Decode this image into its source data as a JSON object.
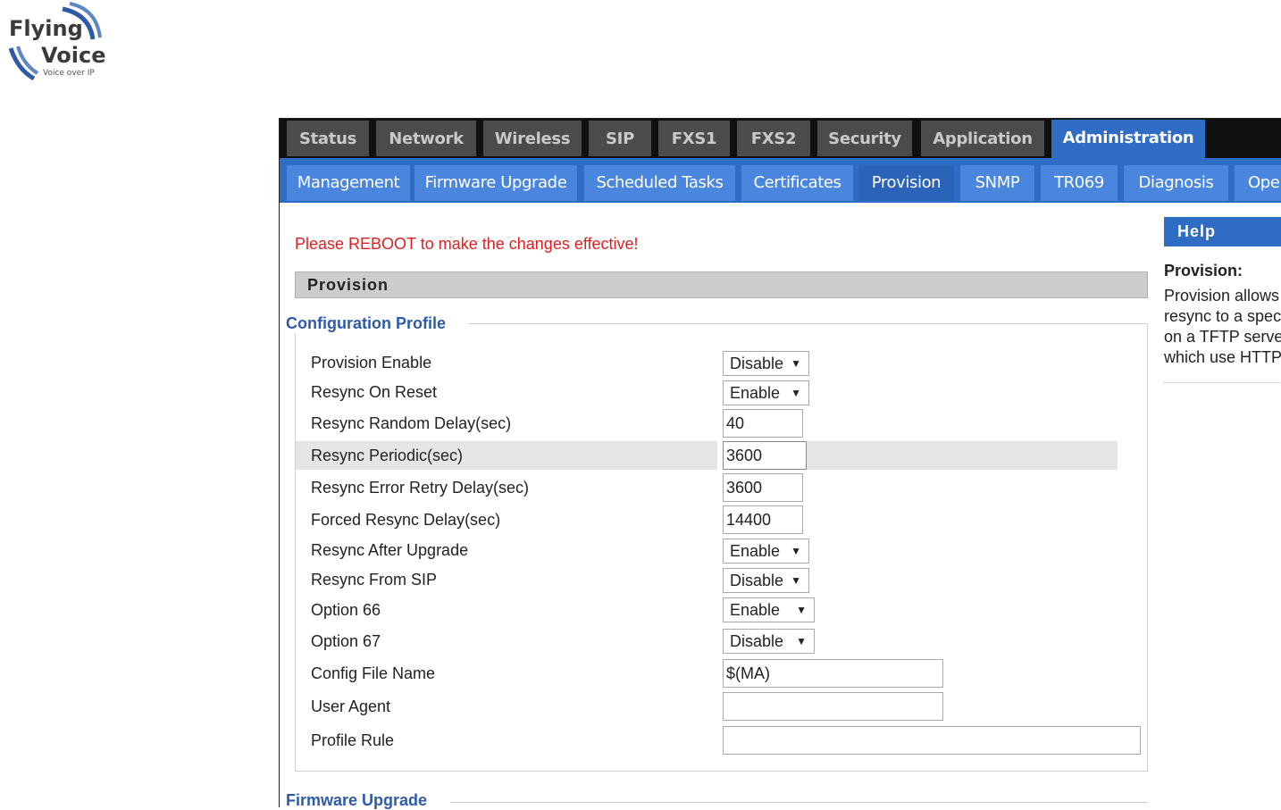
{
  "logo": {
    "line1": "Flying",
    "line2": "Voice",
    "tagline": "Voice over IP"
  },
  "colors": {
    "tab_active": "#2f6cc4",
    "subtab": "#4a86dd",
    "reboot": "#e02020",
    "legend": "#2e5aa8"
  },
  "main_tabs": [
    {
      "label": "Status",
      "active": false
    },
    {
      "label": "Network",
      "active": false
    },
    {
      "label": "Wireless",
      "active": false
    },
    {
      "label": "SIP",
      "active": false
    },
    {
      "label": "FXS1",
      "active": false
    },
    {
      "label": "FXS2",
      "active": false
    },
    {
      "label": "Security",
      "active": false
    },
    {
      "label": "Application",
      "active": false
    },
    {
      "label": "Administration",
      "active": true
    }
  ],
  "sub_tabs": [
    {
      "label": "Management",
      "active": false
    },
    {
      "label": "Firmware Upgrade",
      "active": false
    },
    {
      "label": "Scheduled Tasks",
      "active": false
    },
    {
      "label": "Certificates",
      "active": false
    },
    {
      "label": "Provision",
      "active": true
    },
    {
      "label": "SNMP",
      "active": false
    },
    {
      "label": "TR069",
      "active": false
    },
    {
      "label": "Diagnosis",
      "active": false
    },
    {
      "label": "Oper",
      "active": false
    }
  ],
  "notice": "Please REBOOT to make the changes effective!",
  "section_title": "Provision",
  "config_profile": {
    "legend": "Configuration Profile",
    "fields": [
      {
        "label": "Provision Enable",
        "type": "select",
        "value": "Disable"
      },
      {
        "label": "Resync On Reset",
        "type": "select",
        "value": "Enable"
      },
      {
        "label": "Resync Random Delay(sec)",
        "type": "text",
        "value": "40"
      },
      {
        "label": "Resync Periodic(sec)",
        "type": "text",
        "value": "3600"
      },
      {
        "label": "Resync Error Retry Delay(sec)",
        "type": "text",
        "value": "3600"
      },
      {
        "label": "Forced Resync Delay(sec)",
        "type": "text",
        "value": "14400"
      },
      {
        "label": "Resync After Upgrade",
        "type": "select",
        "value": "Enable"
      },
      {
        "label": "Resync From SIP",
        "type": "select",
        "value": "Disable"
      },
      {
        "label": "Option 66",
        "type": "select",
        "value": "Enable"
      },
      {
        "label": "Option 67",
        "type": "select",
        "value": "Disable"
      },
      {
        "label": "Config File Name",
        "type": "text",
        "value": "$(MA)"
      },
      {
        "label": "User Agent",
        "type": "text",
        "value": ""
      },
      {
        "label": "Profile Rule",
        "type": "text",
        "value": ""
      }
    ]
  },
  "firmware_upgrade": {
    "legend": "Firmware Upgrade"
  },
  "help": {
    "title": "Help",
    "heading": "Provision:",
    "lines": [
      "Provision allows",
      "resync to a speci",
      "on a TFTP server",
      "which use HTTP"
    ]
  }
}
